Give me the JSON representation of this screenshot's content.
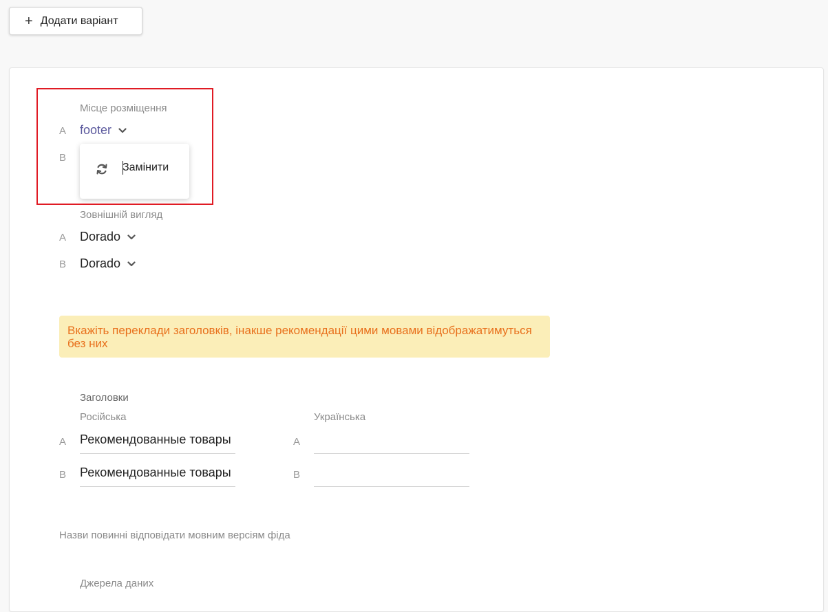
{
  "toolbar": {
    "add_variant_label": "Додати варіант",
    "add_icon": "+"
  },
  "placement": {
    "label": "Місце розміщення",
    "rows": [
      {
        "key": "A",
        "value": "footer"
      },
      {
        "key": "B",
        "value": ""
      }
    ],
    "dropdown": {
      "items": [
        {
          "icon": "refresh-icon",
          "label": "Замінити"
        }
      ]
    }
  },
  "appearance": {
    "label": "Зовнішній вигляд",
    "rows": [
      {
        "key": "A",
        "value": "Dorado"
      },
      {
        "key": "B",
        "value": "Dorado"
      }
    ]
  },
  "warning": {
    "text": "Вкажіть переклади заголовків, інакше рекомендації цими мовами відображатимуться без них"
  },
  "titles": {
    "label": "Заголовки",
    "russian": {
      "label": "Російська",
      "rows": [
        {
          "key": "A",
          "value": "Рекомендованные товары"
        },
        {
          "key": "B",
          "value": "Рекомендованные товары"
        }
      ]
    },
    "ukrainian": {
      "label": "Українська",
      "rows": [
        {
          "key": "A",
          "value": ""
        },
        {
          "key": "B",
          "value": ""
        }
      ]
    }
  },
  "feed_note": "Назви повинні відповідати мовним версіям фіда",
  "data_sources": {
    "label": "Джерела даних"
  },
  "colors": {
    "highlight": "#e01b24",
    "accent": "#5c5a9e",
    "warning_bg": "#fbeeb8",
    "warning_text": "#e8701c"
  }
}
